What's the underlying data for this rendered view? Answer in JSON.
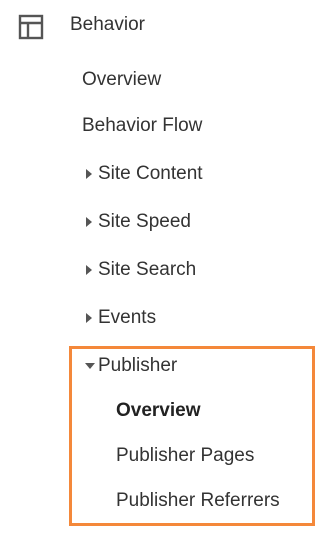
{
  "section": {
    "title": "Behavior",
    "icon": "layout-icon"
  },
  "items": [
    {
      "label": "Overview"
    },
    {
      "label": "Behavior Flow"
    },
    {
      "label": "Site Content",
      "expandable": true,
      "expanded": false
    },
    {
      "label": "Site Speed",
      "expandable": true,
      "expanded": false
    },
    {
      "label": "Site Search",
      "expandable": true,
      "expanded": false
    },
    {
      "label": "Events",
      "expandable": true,
      "expanded": false
    },
    {
      "label": "Publisher",
      "expandable": true,
      "expanded": true
    }
  ],
  "publisher_children": [
    {
      "label": "Overview",
      "active": true
    },
    {
      "label": "Publisher Pages",
      "active": false
    },
    {
      "label": "Publisher Referrers",
      "active": false
    }
  ],
  "colors": {
    "text": "#333333",
    "highlight_border": "#F4883A",
    "caret": "#555555"
  }
}
